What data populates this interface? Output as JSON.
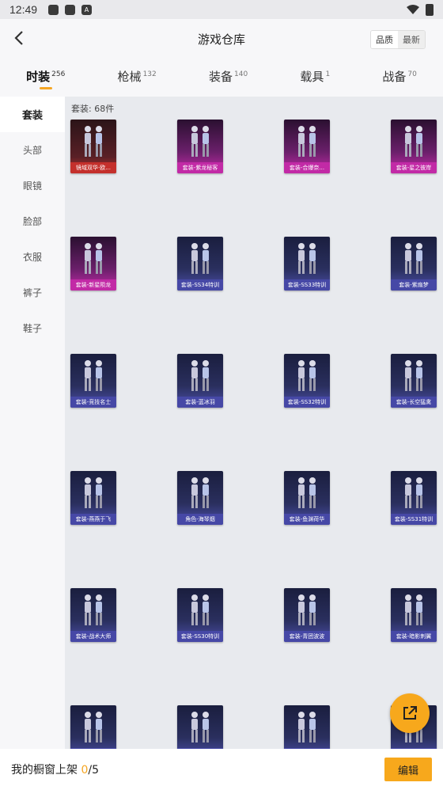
{
  "status": {
    "time": "12:49"
  },
  "header": {
    "title": "游戏仓库",
    "sort_quality": "品质",
    "sort_newest": "最新"
  },
  "tabs": [
    {
      "label": "时装",
      "count": "256"
    },
    {
      "label": "枪械",
      "count": "132"
    },
    {
      "label": "装备",
      "count": "140"
    },
    {
      "label": "载具",
      "count": "1"
    },
    {
      "label": "战备",
      "count": "70"
    }
  ],
  "sidebar": [
    {
      "label": "套装"
    },
    {
      "label": "头部"
    },
    {
      "label": "眼镜"
    },
    {
      "label": "脸部"
    },
    {
      "label": "衣服"
    },
    {
      "label": "裤子"
    },
    {
      "label": "鞋子"
    }
  ],
  "content": {
    "count_label": "套装: 68件"
  },
  "items": [
    {
      "name": "镜域双华·欧...",
      "quality": "red"
    },
    {
      "name": "套装-紫龙秘客",
      "quality": "pink"
    },
    {
      "name": "套装-合爆奈...",
      "quality": "pink"
    },
    {
      "name": "套装-星之彼岸",
      "quality": "pink"
    },
    {
      "name": "套装-新星陨龙",
      "quality": "pink"
    },
    {
      "name": "套装-SS34特训",
      "quality": "blue"
    },
    {
      "name": "套装-SS33特训",
      "quality": "blue"
    },
    {
      "name": "套装-紫扇梦",
      "quality": "blue"
    },
    {
      "name": "套装-竞技名士",
      "quality": "blue"
    },
    {
      "name": "套装-蓝冰羽",
      "quality": "blue"
    },
    {
      "name": "套装-SS32特训",
      "quality": "blue"
    },
    {
      "name": "套装-长空猛禽",
      "quality": "blue"
    },
    {
      "name": "套装-燕燕于飞",
      "quality": "blue"
    },
    {
      "name": "角色-海琴烟",
      "quality": "blue"
    },
    {
      "name": "套装-鱼渊荷华",
      "quality": "blue"
    },
    {
      "name": "套装-SS31特训",
      "quality": "blue"
    },
    {
      "name": "套装-战术大师",
      "quality": "blue"
    },
    {
      "name": "套装-SS30特训",
      "quality": "blue"
    },
    {
      "name": "套装-青团波波",
      "quality": "blue"
    },
    {
      "name": "套装-暗影刺翼",
      "quality": "blue"
    },
    {
      "name": "",
      "quality": "blue"
    },
    {
      "name": "",
      "quality": "blue"
    },
    {
      "name": "",
      "quality": "blue"
    },
    {
      "name": "",
      "quality": "blue"
    }
  ],
  "bottom": {
    "label": "我的橱窗上架 ",
    "current": "0",
    "total": "/5",
    "edit": "编辑"
  },
  "colors": {
    "accent": "#f7a81c",
    "red_quality": "#c4302c",
    "pink_quality": "#c22aa6",
    "blue_quality": "#4648a6"
  }
}
